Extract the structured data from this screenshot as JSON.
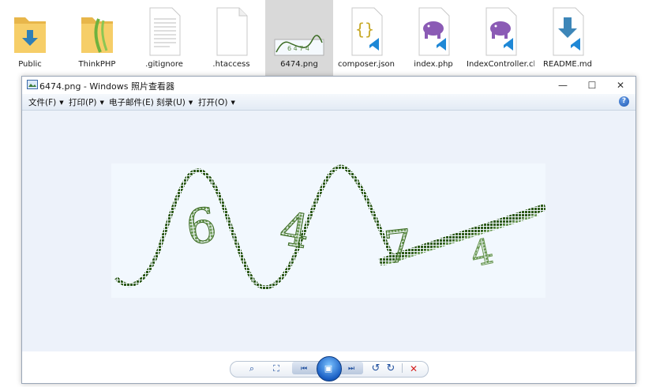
{
  "explorer": {
    "files": [
      {
        "name": "Public",
        "icon": "folder-download-icon"
      },
      {
        "name": "ThinkPHP",
        "icon": "folder-thinkphp-icon"
      },
      {
        "name": ".gitignore",
        "icon": "text-file-icon"
      },
      {
        "name": ".htaccess",
        "icon": "blank-file-icon"
      },
      {
        "name": "6474.png",
        "icon": "image-file-icon",
        "selected": true
      },
      {
        "name": "composer.json",
        "icon": "json-file-icon"
      },
      {
        "name": "index.php",
        "icon": "php-file-icon"
      },
      {
        "name": "IndexController.class.php",
        "icon": "php-file-icon"
      },
      {
        "name": "README.md",
        "icon": "markdown-file-icon"
      }
    ]
  },
  "window": {
    "title": "6474.png - Windows 照片查看器",
    "controls": {
      "minimize": "—",
      "maximize": "☐",
      "close": "✕"
    }
  },
  "menu": {
    "items": [
      {
        "label": "文件(F)",
        "has_dropdown": true
      },
      {
        "label": "打印(P)",
        "has_dropdown": true
      },
      {
        "label": "电子邮件(E)",
        "has_dropdown": false
      },
      {
        "label": "刻录(U)",
        "has_dropdown": true
      },
      {
        "label": "打开(O)",
        "has_dropdown": true
      }
    ],
    "help": "?"
  },
  "image": {
    "filename": "6474.png",
    "chars": [
      "6",
      "4",
      "7",
      "4"
    ],
    "ink_color": "#3a6a22"
  },
  "toolbar": {
    "zoom": "⌕",
    "fit": "⛶",
    "prev": "⏮",
    "slideshow": "▣",
    "next": "⏭",
    "rotate_ccw": "↺",
    "rotate_cw": "↻",
    "delete": "✕"
  },
  "colors": {
    "accent": "#1a5fc4",
    "delete": "#d42020",
    "viewer_bg": "#edf2fa"
  }
}
